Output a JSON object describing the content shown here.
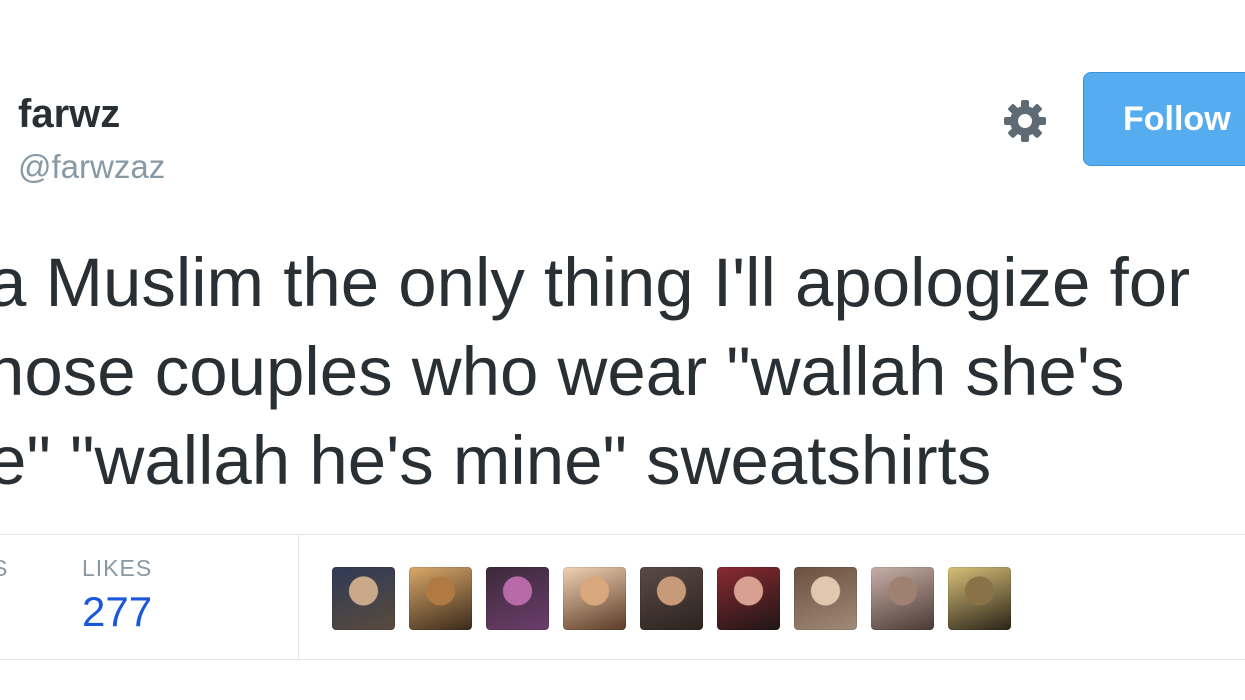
{
  "tweet": {
    "display_name": "farwz",
    "handle": "@farwzaz",
    "follow_label": "Follow",
    "text_lines": [
      "a Muslim the only thing I'll apologize for",
      "hose couples who wear \"wallah she's",
      "e\" \"wallah he's mine\" sweatshirts"
    ]
  },
  "stats": {
    "previous_label_fragment": "S",
    "likes_label": "LIKES",
    "likes_count": "277"
  },
  "likers": [
    {
      "name": "liker-1",
      "colors": [
        "#5a4a3e",
        "#c9a98a",
        "#2f3b55"
      ]
    },
    {
      "name": "liker-2",
      "colors": [
        "#3a2a1c",
        "#b07a42",
        "#d9a868"
      ]
    },
    {
      "name": "liker-3",
      "colors": [
        "#6b3d6b",
        "#b86aa8",
        "#3d2a3a"
      ]
    },
    {
      "name": "liker-4",
      "colors": [
        "#5c3a26",
        "#d9a77c",
        "#f0d2b4"
      ]
    },
    {
      "name": "liker-5",
      "colors": [
        "#2c2420",
        "#c79a7a",
        "#5a4a44"
      ]
    },
    {
      "name": "liker-6",
      "colors": [
        "#1e1616",
        "#d8a090",
        "#8a2a32"
      ]
    },
    {
      "name": "liker-7",
      "colors": [
        "#a08a78",
        "#e0c8b0",
        "#6a5040"
      ]
    },
    {
      "name": "liker-8",
      "colors": [
        "#4a3a34",
        "#a08070",
        "#c8b0a8"
      ]
    },
    {
      "name": "liker-9",
      "colors": [
        "#2a2418",
        "#8a7248",
        "#d8c078"
      ]
    }
  ],
  "colors": {
    "follow_button": "#55acee",
    "likes_count": "#1b57db",
    "muted_text": "#8899a6",
    "body_text": "#292f33"
  }
}
